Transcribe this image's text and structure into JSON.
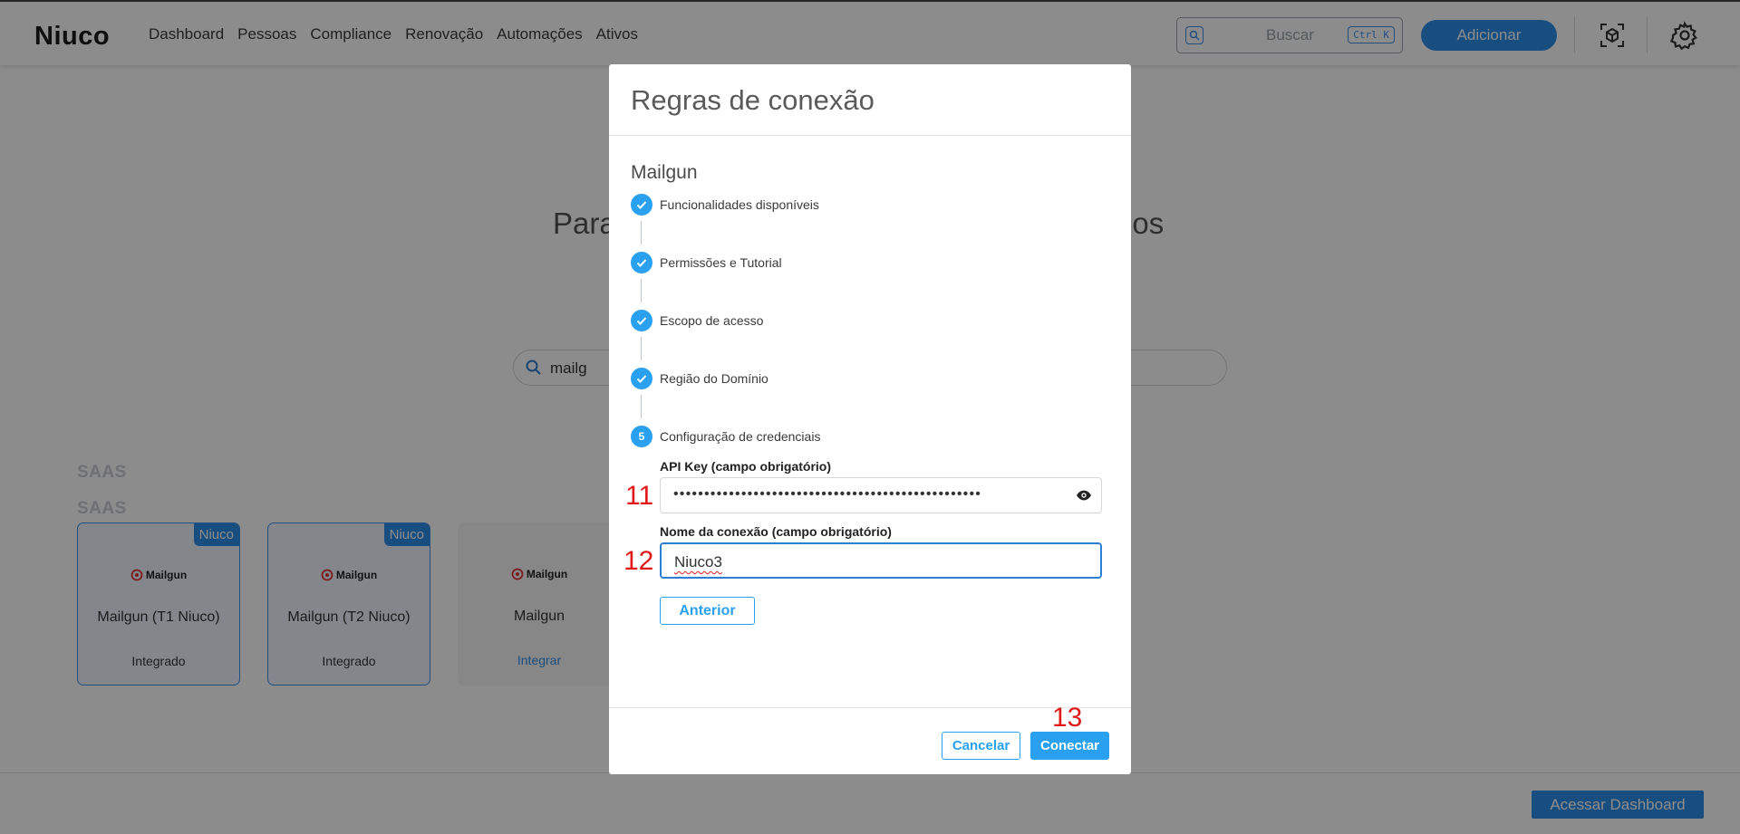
{
  "app": {
    "logo": "Niuco"
  },
  "nav": {
    "items": [
      "Dashboard",
      "Pessoas",
      "Compliance",
      "Renovação",
      "Automações",
      "Ativos"
    ]
  },
  "header": {
    "search_placeholder": "Buscar",
    "search_shortcut": "Ctrl K",
    "add_label": "Adicionar"
  },
  "page": {
    "hero_left": "Para",
    "hero_right": "e-os",
    "search_value": "mailg",
    "section_labels": [
      "SAAS",
      "SAAS"
    ],
    "cards": [
      {
        "badge": "Niuco",
        "logo": "Mailgun",
        "title": "Mailgun (T1 Niuco)",
        "status": "Integrado"
      },
      {
        "badge": "Niuco",
        "logo": "Mailgun",
        "title": "Mailgun (T2 Niuco)",
        "status": "Integrado"
      },
      {
        "badge": "",
        "logo": "Mailgun",
        "title": "Mailgun",
        "status": "Integrar"
      }
    ],
    "dashboard_button": "Acessar Dashboard"
  },
  "modal": {
    "title": "Regras de conexão",
    "integration": "Mailgun",
    "steps": [
      {
        "label": "Funcionalidades disponíveis",
        "state": "done",
        "marker": ""
      },
      {
        "label": "Permissões e Tutorial",
        "state": "done",
        "marker": ""
      },
      {
        "label": "Escopo de acesso",
        "state": "done",
        "marker": ""
      },
      {
        "label": "Região do Domínio",
        "state": "done",
        "marker": ""
      },
      {
        "label": "Configuração de credenciais",
        "state": "current",
        "marker": "5"
      }
    ],
    "api_key": {
      "label": "API Key (campo obrigatório)",
      "value": "••••••••••••••••••••••••••••••••••••••••••••••••••"
    },
    "connection_name": {
      "label": "Nome da conexão (campo obrigatório)",
      "value": "Niuco3"
    },
    "previous_button": "Anterior",
    "cancel_button": "Cancelar",
    "connect_button": "Conectar"
  },
  "annotations": [
    "11",
    "12",
    "13"
  ],
  "colors": {
    "accent": "#29a0f0",
    "primary": "#2d8fe8",
    "annotation": "#e01818"
  }
}
